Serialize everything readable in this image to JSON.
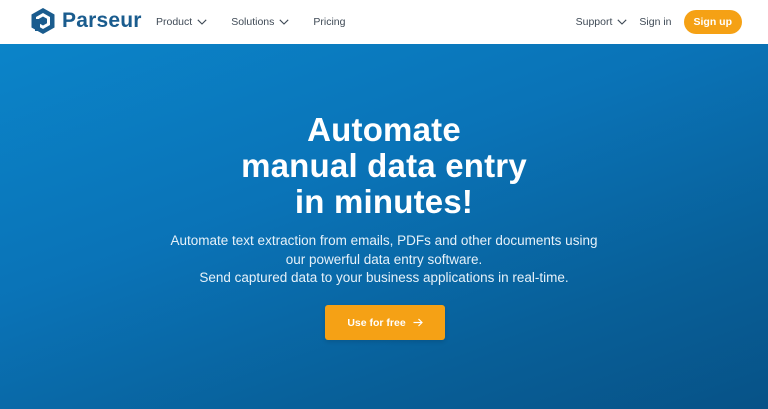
{
  "brand": {
    "name": "Parseur",
    "color": "#1a5c8e"
  },
  "nav": {
    "product": "Product",
    "solutions": "Solutions",
    "pricing": "Pricing",
    "support": "Support",
    "signin": "Sign in",
    "signup": "Sign up"
  },
  "hero": {
    "title": [
      "Automate",
      "manual data entry",
      "in minutes!"
    ],
    "subtitle": [
      "Automate text extraction from emails, PDFs and other documents using",
      "our powerful data entry software.",
      "Send captured data to your business applications in real-time."
    ],
    "cta": "Use for free"
  },
  "colors": {
    "accent": "#f5a115",
    "hero_bg": "#0a73b7"
  },
  "icons": {
    "logo": "parseur-logo-icon",
    "dropdown": "chevron-down-icon",
    "cta": "arrow-right-icon"
  }
}
